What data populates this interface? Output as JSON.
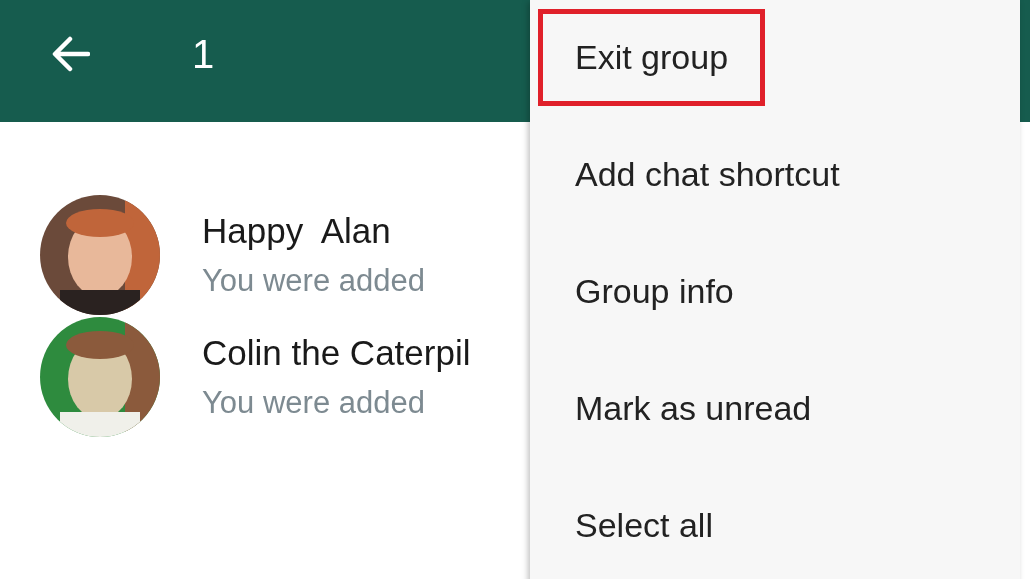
{
  "header": {
    "selected_count": "1"
  },
  "chats": [
    {
      "name": "Happy  Alan",
      "subtitle": "You were added",
      "kind": "picture"
    },
    {
      "name": "Colin the Caterpil",
      "subtitle": "You were added",
      "kind": "picture"
    }
  ],
  "menu": {
    "items": [
      {
        "label": "Exit group",
        "highlighted": true
      },
      {
        "label": "Add chat shortcut",
        "highlighted": false
      },
      {
        "label": "Group info",
        "highlighted": false
      },
      {
        "label": "Mark as unread",
        "highlighted": false
      },
      {
        "label": "Select all",
        "highlighted": false
      }
    ]
  }
}
